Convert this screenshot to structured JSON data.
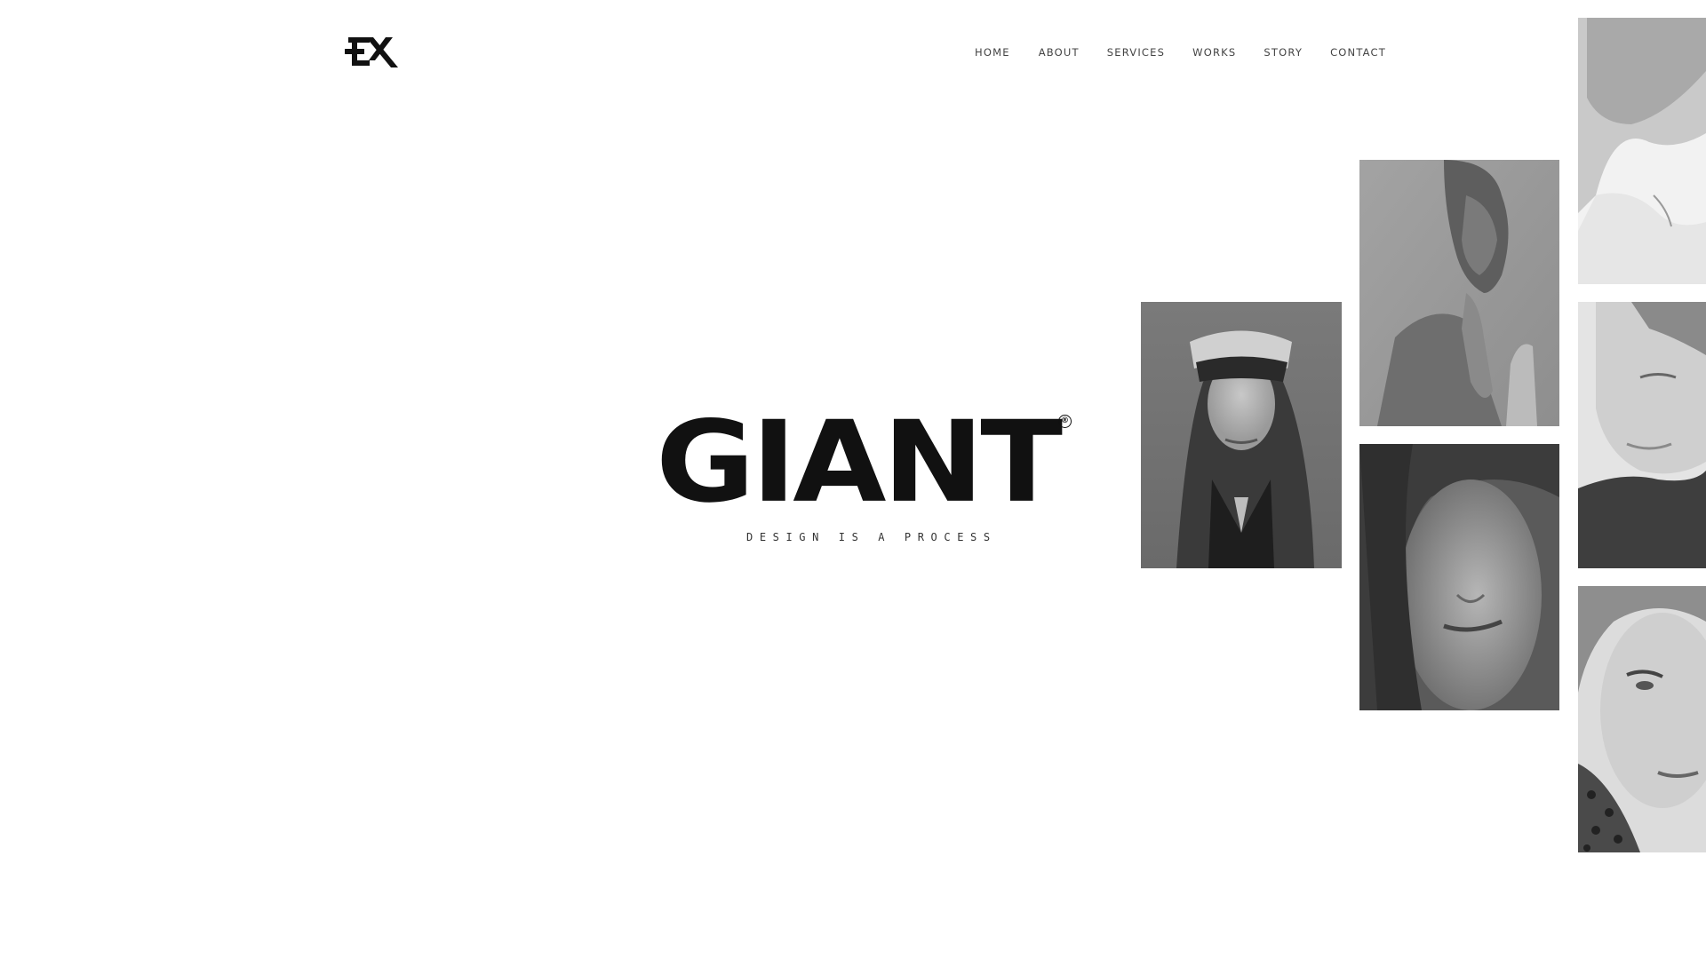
{
  "header": {
    "logo_icon": "ex-monogram-logo",
    "nav": [
      {
        "label": "HOME"
      },
      {
        "label": "ABOUT"
      },
      {
        "label": "SERVICES"
      },
      {
        "label": "WORKS"
      },
      {
        "label": "STORY"
      },
      {
        "label": "CONTACT"
      }
    ]
  },
  "hero": {
    "title": "GIANT",
    "registered_mark": "®",
    "tagline": "DESIGN IS A PROCESS"
  },
  "gallery": {
    "photos": [
      {
        "name": "portrait-woman-visor"
      },
      {
        "name": "portrait-woman-hand-to-lips"
      },
      {
        "name": "portrait-woman-closeup-dark"
      },
      {
        "name": "portrait-boy-looking-down"
      },
      {
        "name": "portrait-man-turtleneck"
      },
      {
        "name": "portrait-woman-leopard-scarf"
      }
    ]
  },
  "colors": {
    "background": "#ffffff",
    "text": "#111111",
    "nav_text": "#444444"
  }
}
